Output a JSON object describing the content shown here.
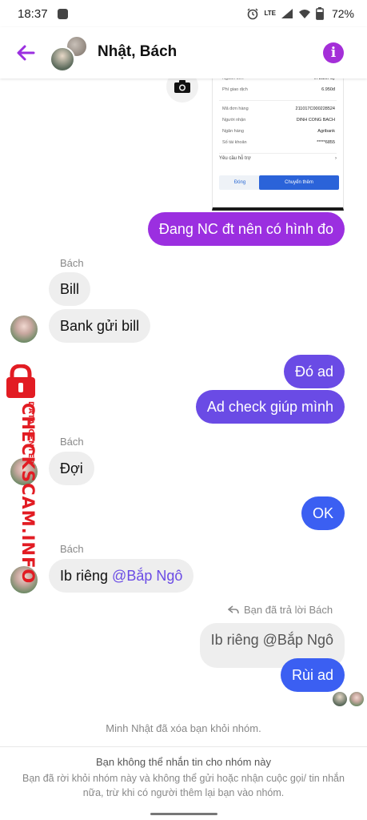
{
  "status_bar": {
    "time": "18:37",
    "battery": "72%",
    "lte_label": "LTE"
  },
  "header": {
    "title": "Nhật, Bách"
  },
  "shared_image": {
    "rows": [
      {
        "label": "Nguồn tiền",
        "value": "Ví ZaloPay"
      },
      {
        "label": "Phí giao dịch",
        "value": "6.950đ"
      },
      {
        "label": "Mã đơn hàng",
        "value": "211017C000228524"
      },
      {
        "label": "Người nhận",
        "value": "DINH CONG BACH"
      },
      {
        "label": "Ngân hàng",
        "value": "Agribank"
      },
      {
        "label": "Số tài khoản",
        "value": "*****6855"
      }
    ],
    "support": "Yêu cầu hỗ trợ",
    "close_button": "Đóng",
    "transfer_more_button": "Chuyển thêm"
  },
  "messages": [
    {
      "text": "Đang NC đt nên có hình đo"
    },
    {
      "sender": "Bách"
    },
    {
      "text": "Bill"
    },
    {
      "text": "Bank gửi bill"
    },
    {
      "text": "Đó ad"
    },
    {
      "text": "Ad check giúp mình"
    },
    {
      "sender": "Bách"
    },
    {
      "text": "Đợi"
    },
    {
      "text": "OK"
    },
    {
      "sender": "Bách"
    },
    {
      "text_prefix": "Ib riêng ",
      "mention": "@Bắp Ngô"
    },
    {
      "reply_note": "Bạn đã trả lời Bách",
      "quoted": "Ib riêng @Bắp Ngô"
    },
    {
      "text": "Rùi ad"
    }
  ],
  "system_note": "Minh Nhật đã xóa bạn khỏi nhóm.",
  "footer": {
    "title": "Bạn không thể nhắn tin cho nhóm này",
    "body": "Bạn đã rời khỏi nhóm này và không thể gửi hoặc nhận cuộc gọi/ tin nhắn nữa, trừ khi có người thêm lại bạn vào nhóm."
  },
  "watermark": {
    "main": "CHECKSCAM.INFO",
    "sub": "DATA CENTER"
  },
  "colors": {
    "accent_purple": "#9b2fe0",
    "accent_violet": "#6a4be5",
    "accent_blue": "#3b5ff2",
    "watermark_red": "#e21c23"
  },
  "icons": [
    "back-arrow-icon",
    "info-icon",
    "camera-icon",
    "reply-arrow-icon",
    "lock-icon"
  ]
}
